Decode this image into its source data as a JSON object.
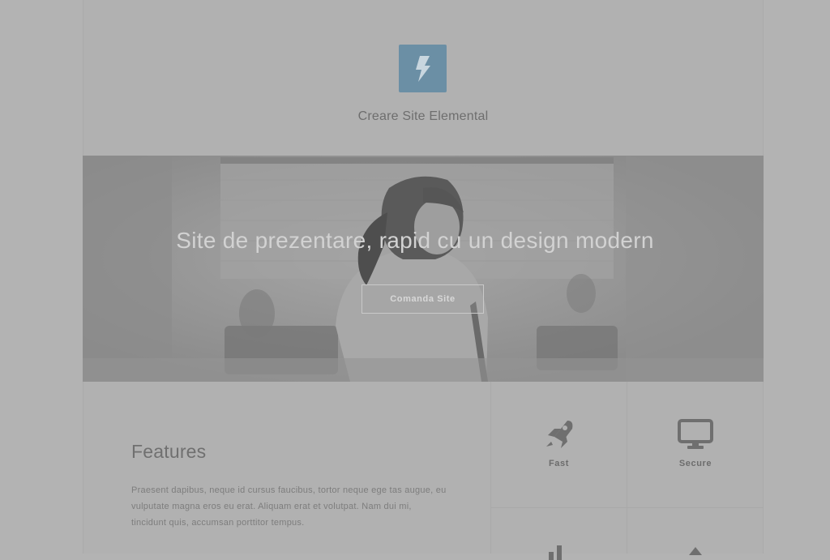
{
  "header": {
    "site_name": "Creare Site Elemental",
    "logo_icon": "lightning-bolt-icon",
    "logo_color": "#6b8fa5"
  },
  "hero": {
    "title": "Site de prezentare, rapid cu un design modern",
    "button_label": "Comanda Site"
  },
  "features": {
    "title": "Features",
    "text": "Praesent dapibus, neque id cursus faucibus, tortor neque ege tas augue, eu vulputate magna eros eu erat. Aliquam erat et volutpat. Nam dui mi, tincidunt quis, accumsan porttitor tempus.",
    "items": [
      {
        "label": "Fast",
        "icon": "rocket-icon"
      },
      {
        "label": "Secure",
        "icon": "monitor-icon"
      },
      {
        "label": "",
        "icon": "chart-icon"
      },
      {
        "label": "",
        "icon": "arrow-icon"
      }
    ]
  }
}
